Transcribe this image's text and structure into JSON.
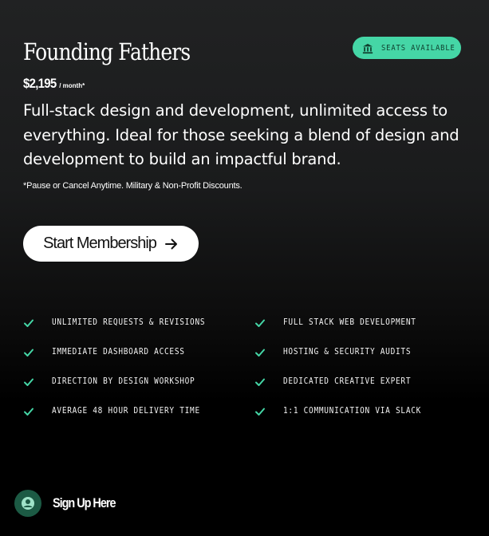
{
  "plan": {
    "title": "Founding Fathers",
    "badge": {
      "label": "SEATS AVAILABLE",
      "icon": "bank-icon"
    },
    "price": {
      "amount": "$2,195",
      "period": "/ month*"
    },
    "description": "Full-stack design and development, unlimited access to everything. Ideal for those seeking a blend of design and development to build an impactful brand.",
    "note": "*Pause or Cancel Anytime. Military & Non-Profit Discounts.",
    "cta": {
      "label": "Start Membership",
      "icon": "arrow-right-icon"
    }
  },
  "features": {
    "left": [
      "UNLIMITED REQUESTS & REVISIONS",
      "IMMEDIATE DASHBOARD ACCESS",
      "DIRECTION BY DESIGN WORKSHOP",
      "AVERAGE 48 HOUR DELIVERY TIME"
    ],
    "right": [
      "FULL STACK WEB DEVELOPMENT",
      "HOSTING & SECURITY AUDITS",
      "DEDICATED CREATIVE EXPERT",
      "1:1 COMMUNICATION VIA SLACK"
    ],
    "icon": "check-icon"
  },
  "signup": {
    "label": "Sign Up Here",
    "icon": "user-icon"
  },
  "colors": {
    "accent": "#45d6a6",
    "check": "#45d6a6",
    "signup_circle": "#1c5a44"
  }
}
